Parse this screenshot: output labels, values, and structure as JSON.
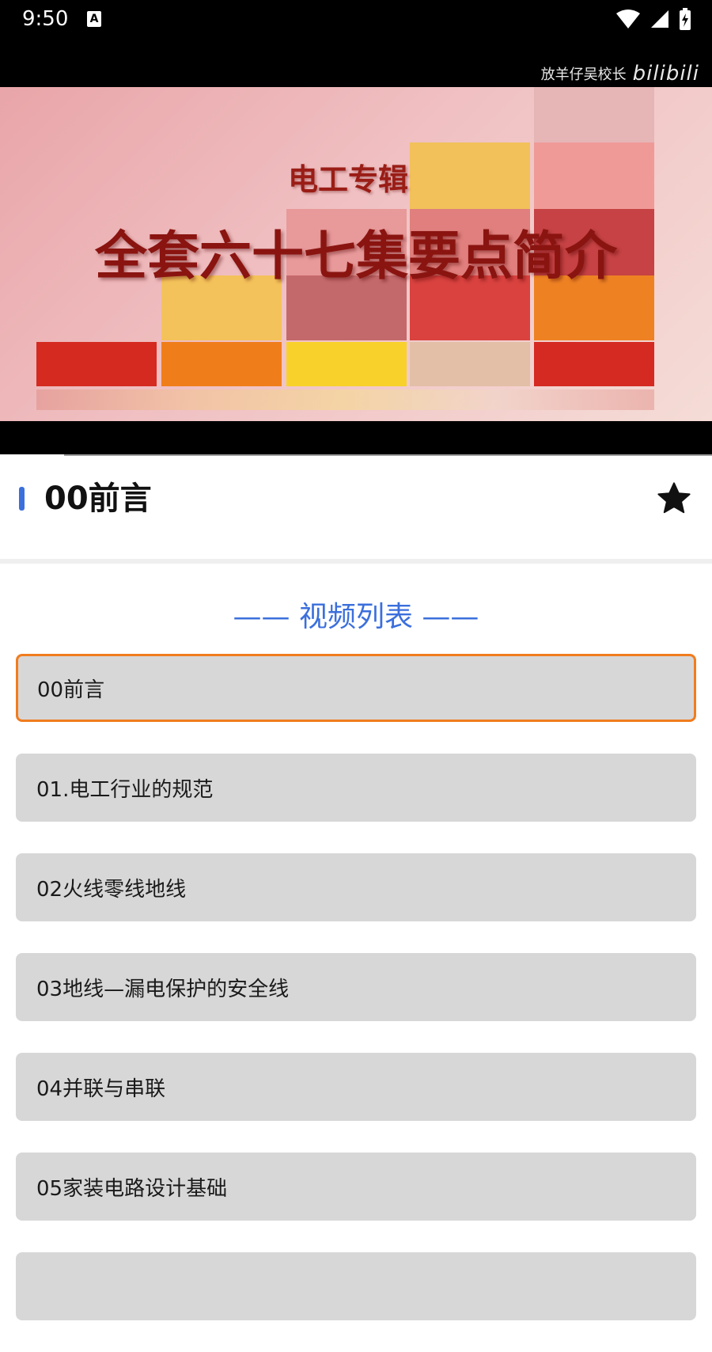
{
  "status_bar": {
    "time": "9:50",
    "a_icon": "A"
  },
  "video": {
    "watermark_author": "放羊仔吴校长",
    "watermark_logo": "bilibili",
    "frame_subtitle": "电工专辑",
    "frame_title": "全套六十七集要点简介",
    "progress": 0.09
  },
  "title_bar": {
    "title": "00前言",
    "favorite_icon": "star-icon"
  },
  "list": {
    "heading": "—— 视频列表 ——",
    "items": [
      {
        "label": "00前言",
        "active": true
      },
      {
        "label": "01.电工行业的规范",
        "active": false
      },
      {
        "label": "02火线零线地线",
        "active": false
      },
      {
        "label": "03地线—漏电保护的安全线",
        "active": false
      },
      {
        "label": "04并联与串联",
        "active": false
      },
      {
        "label": "05家装电路设计基础",
        "active": false
      },
      {
        "label": "",
        "active": false
      }
    ]
  },
  "colors": {
    "accent_blue": "#3b6fdc",
    "active_border": "#f07c1e",
    "item_bg": "#d8d7d8"
  }
}
